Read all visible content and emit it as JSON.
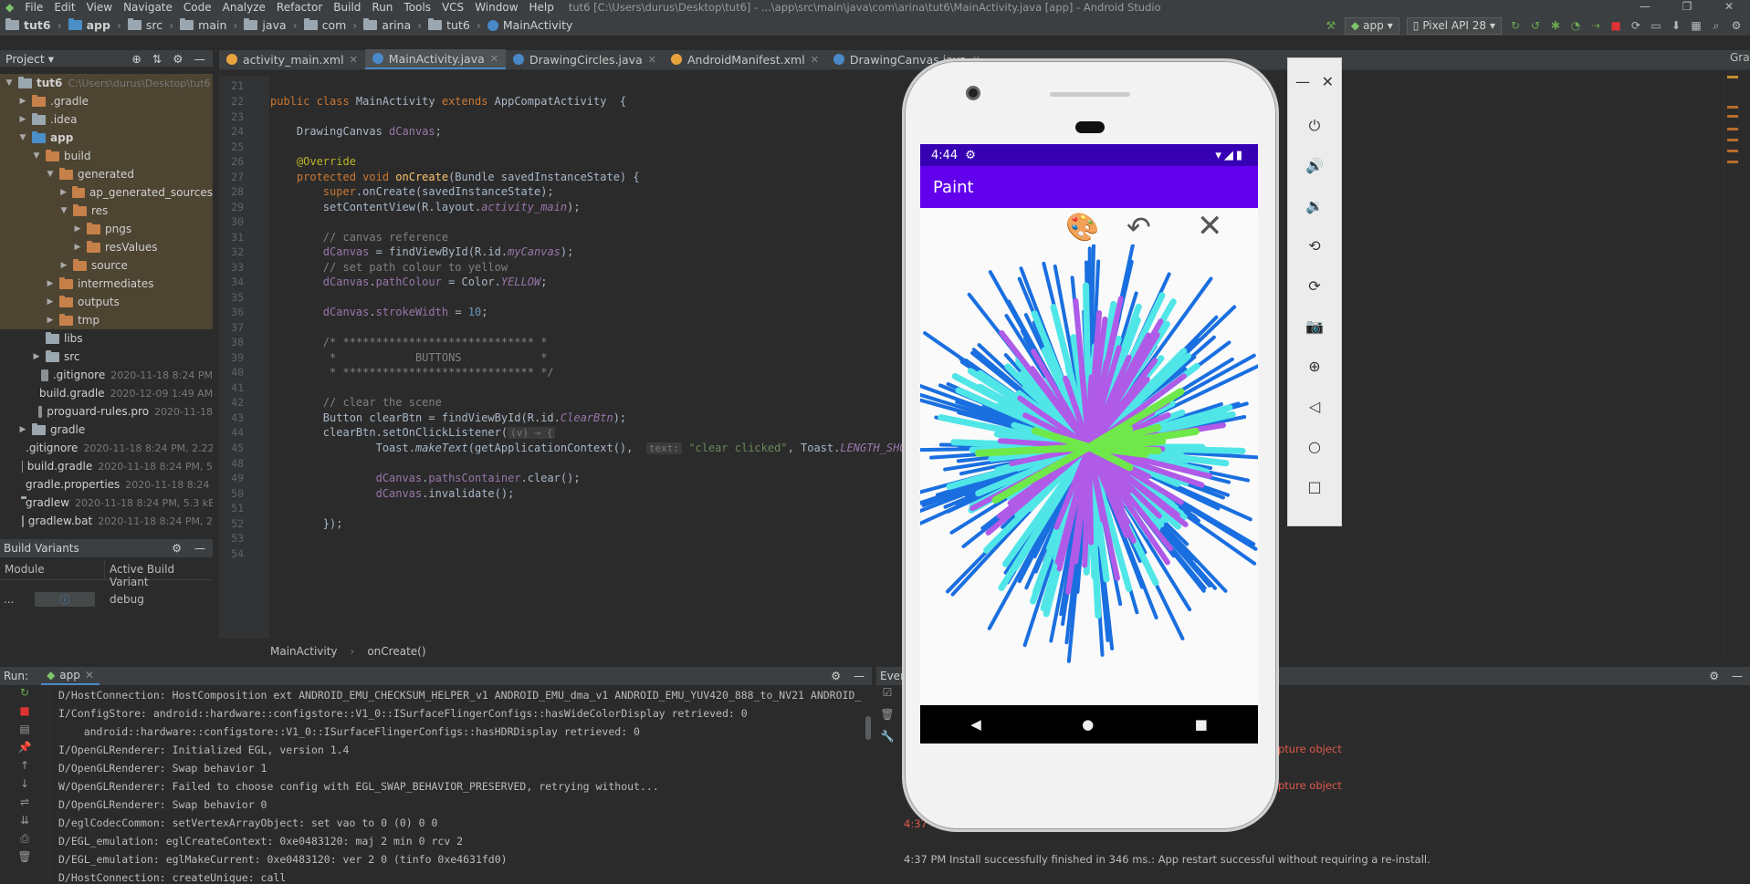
{
  "menu": {
    "items": [
      "File",
      "Edit",
      "View",
      "Navigate",
      "Code",
      "Analyze",
      "Refactor",
      "Build",
      "Run",
      "Tools",
      "VCS",
      "Window",
      "Help"
    ],
    "window_title": "tut6 [C:\\Users\\durus\\Desktop\\tut6] - ...\\app\\src\\main\\java\\com\\arina\\tut6\\MainActivity.java [app] - Android Studio"
  },
  "breadcrumb": [
    "tut6",
    "app",
    "src",
    "main",
    "java",
    "com",
    "arina",
    "tut6",
    "MainActivity"
  ],
  "toolbar": {
    "config": "app",
    "device": "Pixel API 28"
  },
  "project": {
    "title": "Project"
  },
  "tree": [
    {
      "label": "tut6",
      "meta": "C:\\Users\\durus\\Desktop\\tut6",
      "indent": 0,
      "arrow": "▼",
      "hl": true
    },
    {
      "label": ".gradle",
      "meta": "",
      "indent": 1,
      "arrow": "▶",
      "hl": true
    },
    {
      "label": ".idea",
      "meta": "",
      "indent": 1,
      "arrow": "▶",
      "hl": true
    },
    {
      "label": "app",
      "meta": "",
      "indent": 1,
      "arrow": "▼",
      "hl": true
    },
    {
      "label": "build",
      "meta": "",
      "indent": 2,
      "arrow": "▼",
      "hl": true
    },
    {
      "label": "generated",
      "meta": "",
      "indent": 3,
      "arrow": "▼",
      "hl": true
    },
    {
      "label": "ap_generated_sources",
      "meta": "",
      "indent": 4,
      "arrow": "▶",
      "hl": true
    },
    {
      "label": "res",
      "meta": "",
      "indent": 4,
      "arrow": "▼",
      "hl": true
    },
    {
      "label": "pngs",
      "meta": "",
      "indent": 5,
      "arrow": "▶",
      "hl": true
    },
    {
      "label": "resValues",
      "meta": "",
      "indent": 5,
      "arrow": "▶",
      "hl": true
    },
    {
      "label": "source",
      "meta": "",
      "indent": 4,
      "arrow": "▶",
      "hl": true
    },
    {
      "label": "intermediates",
      "meta": "",
      "indent": 3,
      "arrow": "▶",
      "hl": true
    },
    {
      "label": "outputs",
      "meta": "",
      "indent": 3,
      "arrow": "▶",
      "hl": true
    },
    {
      "label": "tmp",
      "meta": "",
      "indent": 3,
      "arrow": "▶",
      "hl": true
    },
    {
      "label": "libs",
      "meta": "",
      "indent": 2,
      "arrow": "",
      "hl": false
    },
    {
      "label": "src",
      "meta": "",
      "indent": 2,
      "arrow": "▶",
      "hl": false
    },
    {
      "label": ".gitignore",
      "meta": "2020-11-18 8:24 PM",
      "indent": 2,
      "arrow": "",
      "hl": false
    },
    {
      "label": "build.gradle",
      "meta": "2020-12-09 1:49 AM",
      "indent": 2,
      "arrow": "",
      "hl": false
    },
    {
      "label": "proguard-rules.pro",
      "meta": "2020-11-18",
      "indent": 2,
      "arrow": "",
      "hl": false
    },
    {
      "label": "gradle",
      "meta": "",
      "indent": 1,
      "arrow": "▶",
      "hl": false
    },
    {
      "label": ".gitignore",
      "meta": "2020-11-18 8:24 PM, 2.22",
      "indent": 1,
      "arrow": "",
      "hl": false
    },
    {
      "label": "build.gradle",
      "meta": "2020-11-18 8:24 PM, 5",
      "indent": 1,
      "arrow": "",
      "hl": false
    },
    {
      "label": "gradle.properties",
      "meta": "2020-11-18 8:24 P",
      "indent": 1,
      "arrow": "",
      "hl": false
    },
    {
      "label": "gradlew",
      "meta": "2020-11-18 8:24 PM, 5.3 kB",
      "indent": 1,
      "arrow": "",
      "hl": false
    },
    {
      "label": "gradlew.bat",
      "meta": "2020-11-18 8:24 PM, 2",
      "indent": 1,
      "arrow": "",
      "hl": false
    }
  ],
  "tabs": [
    {
      "label": "activity_main.xml",
      "color": "#e8a33d",
      "active": false
    },
    {
      "label": "MainActivity.java",
      "color": "#4a88c7",
      "active": true
    },
    {
      "label": "DrawingCircles.java",
      "color": "#4a88c7",
      "active": false
    },
    {
      "label": "AndroidManifest.xml",
      "color": "#e8a33d",
      "active": false
    },
    {
      "label": "DrawingCanvas.java",
      "color": "#4a88c7",
      "active": false
    }
  ],
  "code": [
    {
      "n": "21",
      "h": ""
    },
    {
      "n": "22",
      "h": "<span class='kw'>public class </span>MainActivity <span class='kw'>extends </span>AppCompatActivity  {"
    },
    {
      "n": "23",
      "h": ""
    },
    {
      "n": "24",
      "h": "    DrawingCanvas <span class='fd'>dCanvas</span>;"
    },
    {
      "n": "25",
      "h": ""
    },
    {
      "n": "26",
      "h": "    <span class='an'>@Override</span>"
    },
    {
      "n": "27",
      "h": "    <span class='kw'>protected void </span><span class='fn'>onCreate</span>(Bundle savedInstanceState) {"
    },
    {
      "n": "28",
      "h": "        <span class='kw'>super</span>.onCreate(savedInstanceState);"
    },
    {
      "n": "29",
      "h": "        setContentView(R.layout.<span class='fd it'>activity_main</span>);"
    },
    {
      "n": "30",
      "h": ""
    },
    {
      "n": "31",
      "h": "        <span class='cm'>// canvas reference</span>"
    },
    {
      "n": "32",
      "h": "        <span class='fd'>dCanvas</span> = findViewById(R.id.<span class='fd it'>myCanvas</span>);"
    },
    {
      "n": "33",
      "h": "        <span class='cm'>// set path colour to yellow</span>"
    },
    {
      "n": "34",
      "h": "        <span class='fd'>dCanvas</span>.<span class='fd'>pathColour</span> = Color.<span class='fd it'>YELLOW</span>;"
    },
    {
      "n": "35",
      "h": ""
    },
    {
      "n": "36",
      "h": "        <span class='fd'>dCanvas</span>.<span class='fd'>strokeWidth</span> = <span style='color:#6897bb'>10</span>;"
    },
    {
      "n": "37",
      "h": ""
    },
    {
      "n": "38",
      "h": "        <span class='cm'>/* ***************************** *</span>"
    },
    {
      "n": "39",
      "h": "<span class='cm'>         *            BUTTONS            *</span>"
    },
    {
      "n": "40",
      "h": "<span class='cm'>         * ***************************** */</span>"
    },
    {
      "n": "41",
      "h": ""
    },
    {
      "n": "42",
      "h": "        <span class='cm'>// clear the scene</span>"
    },
    {
      "n": "43",
      "h": "        Button clearBtn = findViewById(R.id.<span class='fd it'>ClearBtn</span>);"
    },
    {
      "n": "44",
      "h": "        clearBtn.setOnClickListener(<span class='hint'>(v) → {</span>"
    },
    {
      "n": "45",
      "h": "                Toast.<span class='it'>makeText</span>(getApplicationContext(),  <span class='hint'>text:</span> <span class='st'>\"clear clicked\"</span>, Toast.<span class='fd it'>LENGTH_SHORT</span>).s"
    },
    {
      "n": "48",
      "h": ""
    },
    {
      "n": "49",
      "h": "                <span class='fd'>dCanvas</span>.<span class='fd'>pathsContainer</span>.clear();"
    },
    {
      "n": "50",
      "h": "                <span class='fd'>dCanvas</span>.invalidate();"
    },
    {
      "n": "51",
      "h": ""
    },
    {
      "n": "52",
      "h": "        });"
    },
    {
      "n": "53",
      "h": ""
    },
    {
      "n": "54",
      "h": ""
    }
  ],
  "code_breadcrumb": [
    "MainActivity",
    "onCreate()"
  ],
  "build_variants": {
    "title": "Build Variants",
    "col_module": "Module",
    "col_variant": "Active Build Variant",
    "module": "...",
    "variant": "debug"
  },
  "run": {
    "label": "Run:",
    "tab": "app"
  },
  "log": [
    "D/HostConnection: HostComposition ext ANDROID_EMU_CHECKSUM_HELPER_v1 ANDROID_EMU_dma_v1 ANDROID_EMU_YUV420_888_to_NV21 ANDROID_",
    "I/ConfigStore: android::hardware::configstore::V1_0::ISurfaceFlingerConfigs::hasWideColorDisplay retrieved: 0",
    "    android::hardware::configstore::V1_0::ISurfaceFlingerConfigs::hasHDRDisplay retrieved: 0",
    "I/OpenGLRenderer: Initialized EGL, version 1.4",
    "D/OpenGLRenderer: Swap behavior 1",
    "W/OpenGLRenderer: Failed to choose config with EGL_SWAP_BEHAVIOR_PRESERVED, retrying without...",
    "D/OpenGLRenderer: Swap behavior 0",
    "D/eglCodecCommon: setVertexArrayObject: set vao to 0 (0) 0 0",
    "D/EGL_emulation: eglCreateContext: 0xe0483120: maj 2 min 0 rcv 2",
    "D/EGL_emulation: eglMakeCurrent: 0xe0483120: ver 2 0 (tinfo 0xe4631fd0)",
    "D/HostConnection: createUnique: call"
  ],
  "events": {
    "title": "Ever",
    "err1": "pture object",
    "err2": "pture object",
    "time1": "4:37",
    "time2": "4:37 PM",
    "msg": "Install successfully finished in 346 ms.: App restart successful without requiring a re-install."
  },
  "phone": {
    "time": "4:44",
    "app_title": "Paint"
  },
  "right_label": "Grac"
}
